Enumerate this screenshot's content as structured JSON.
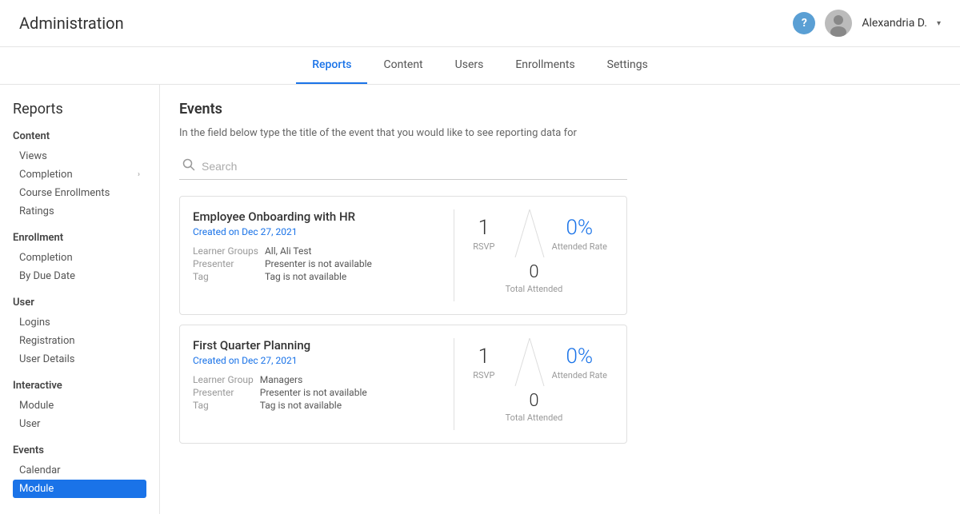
{
  "app": {
    "title": "Administration"
  },
  "header": {
    "help_label": "?",
    "user_name": "Alexandria D.",
    "chevron": "▾"
  },
  "top_nav": {
    "items": [
      {
        "id": "reports",
        "label": "Reports",
        "active": true
      },
      {
        "id": "content",
        "label": "Content",
        "active": false
      },
      {
        "id": "users",
        "label": "Users",
        "active": false
      },
      {
        "id": "enrollments",
        "label": "Enrollments",
        "active": false
      },
      {
        "id": "settings",
        "label": "Settings",
        "active": false
      }
    ]
  },
  "sidebar": {
    "title": "Reports",
    "sections": [
      {
        "label": "Content",
        "items": [
          {
            "id": "views",
            "label": "Views",
            "arrow": false,
            "active": false
          },
          {
            "id": "completion",
            "label": "Completion",
            "arrow": true,
            "active": false
          },
          {
            "id": "course-enrollments",
            "label": "Course Enrollments",
            "arrow": false,
            "active": false
          },
          {
            "id": "ratings",
            "label": "Ratings",
            "arrow": false,
            "active": false
          }
        ]
      },
      {
        "label": "Enrollment",
        "items": [
          {
            "id": "enrollment-completion",
            "label": "Completion",
            "arrow": false,
            "active": false
          },
          {
            "id": "by-due-date",
            "label": "By Due Date",
            "arrow": false,
            "active": false
          }
        ]
      },
      {
        "label": "User",
        "items": [
          {
            "id": "logins",
            "label": "Logins",
            "arrow": false,
            "active": false
          },
          {
            "id": "registration",
            "label": "Registration",
            "arrow": false,
            "active": false
          },
          {
            "id": "user-details",
            "label": "User Details",
            "arrow": false,
            "active": false
          }
        ]
      },
      {
        "label": "Interactive",
        "items": [
          {
            "id": "interactive-module",
            "label": "Module",
            "arrow": false,
            "active": false
          },
          {
            "id": "interactive-user",
            "label": "User",
            "arrow": false,
            "active": false
          }
        ]
      },
      {
        "label": "Events",
        "items": [
          {
            "id": "calendar",
            "label": "Calendar",
            "arrow": false,
            "active": false
          },
          {
            "id": "module",
            "label": "Module",
            "arrow": false,
            "active": true
          }
        ]
      }
    ]
  },
  "main": {
    "title": "Events",
    "description": "In the field below type the title of the event that you would like to see reporting data for",
    "search": {
      "placeholder": "Search"
    },
    "events": [
      {
        "id": "event-1",
        "title": "Employee Onboarding with HR",
        "date": "Created on Dec 27, 2021",
        "learner_groups_label": "Learner Groups",
        "learner_groups_value": "All, Ali Test",
        "presenter_label": "Presenter",
        "presenter_value": "Presenter is not available",
        "tag_label": "Tag",
        "tag_value": "Tag is not available",
        "rsvp": "1",
        "rsvp_label": "RSVP",
        "attended_rate": "0%",
        "attended_rate_label": "Attended Rate",
        "total_attended": "0",
        "total_attended_label": "Total Attended"
      },
      {
        "id": "event-2",
        "title": "First Quarter Planning",
        "date": "Created on Dec 27, 2021",
        "learner_groups_label": "Learner Group",
        "learner_groups_value": "Managers",
        "presenter_label": "Presenter",
        "presenter_value": "Presenter is not available",
        "tag_label": "Tag",
        "tag_value": "Tag is not available",
        "rsvp": "1",
        "rsvp_label": "RSVP",
        "attended_rate": "0%",
        "attended_rate_label": "Attended Rate",
        "total_attended": "0",
        "total_attended_label": "Total Attended"
      }
    ]
  },
  "colors": {
    "accent": "#1a73e8",
    "active_bg": "#1a73e8",
    "border": "#e0e0e0"
  }
}
